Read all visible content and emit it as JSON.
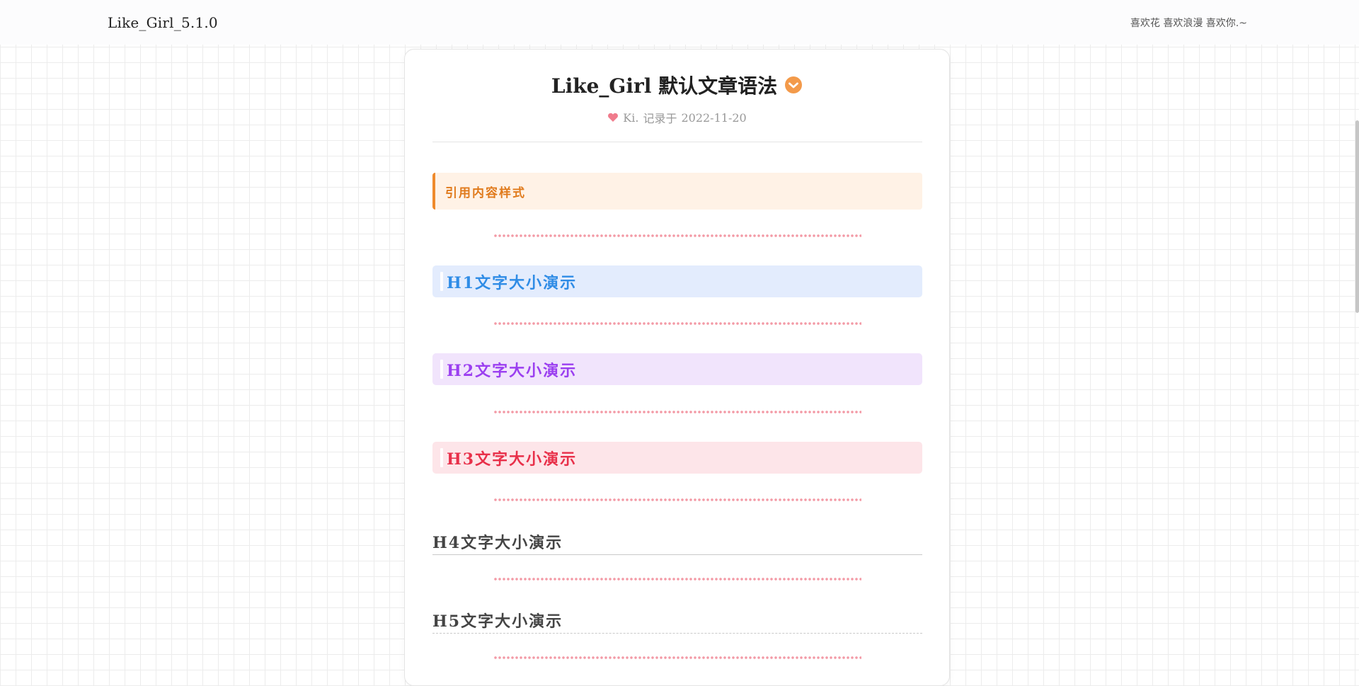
{
  "header": {
    "brand": "Like_Girl_5.1.0",
    "slogan": "喜欢花 喜欢浪漫 喜欢你.~"
  },
  "article": {
    "title": "Like_Girl 默认文章语法",
    "author": "Ki.",
    "recorded_label": "记录于",
    "date": "2022-11-20",
    "quote": "引用内容样式",
    "h1": "H1文字大小演示",
    "h2": "H2文字大小演示",
    "h3": "H3文字大小演示",
    "h4": "H4文字大小演示",
    "h5": "H5文字大小演示"
  },
  "colors": {
    "accent_orange": "#ef8a2c",
    "h1_color": "#2f8ce6",
    "h2_color": "#9b3ff0",
    "h3_color": "#e8304a",
    "dots": "#f39aa6"
  },
  "icons": {
    "title_badge": "check-circle-icon",
    "author_mark": "heart-icon"
  }
}
